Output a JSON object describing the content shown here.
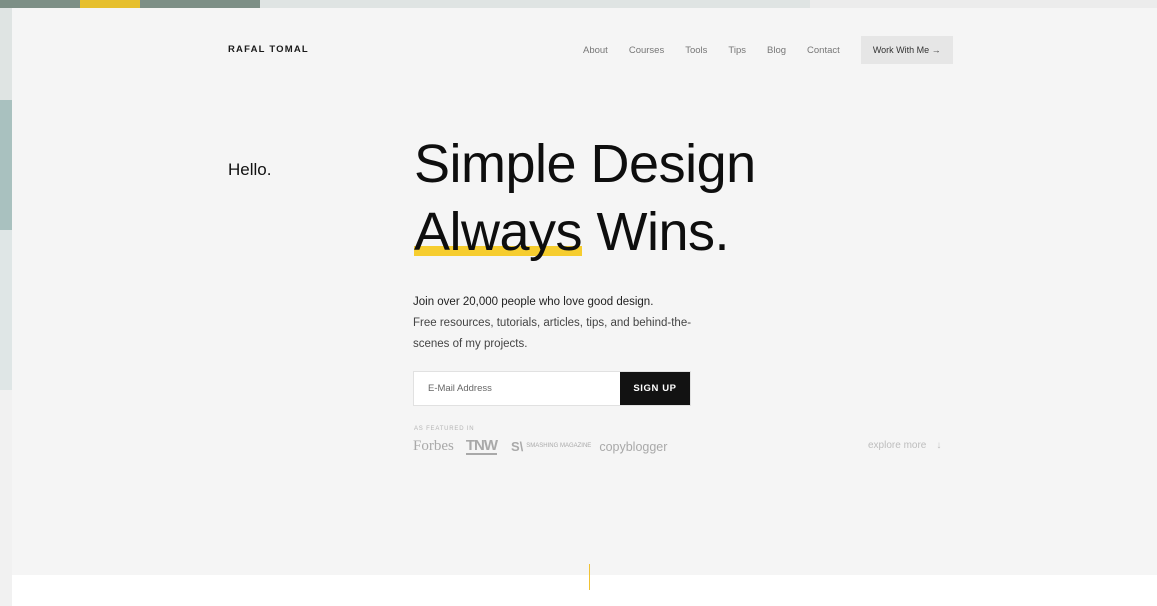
{
  "header": {
    "logo": "RAFAL TOMAL",
    "nav": [
      "About",
      "Courses",
      "Tools",
      "Tips",
      "Blog",
      "Contact"
    ],
    "cta_label": "Work With Me →"
  },
  "hero": {
    "greeting": "Hello.",
    "headline_line1": "Simple Design",
    "headline_highlight": "Always",
    "headline_rest": " Wins.",
    "lead_strong": "Join over 20,000 people who love good design.",
    "lead_sub": "Free resources, tutorials, articles, tips, and behind-the-scenes of my projects."
  },
  "signup": {
    "placeholder": "E-Mail Address",
    "button_label": "SIGN UP"
  },
  "featured": {
    "label": "AS FEATURED IN",
    "logos": {
      "forbes": "Forbes",
      "tnw": "TNW",
      "smashing_mark": "S\\",
      "smashing_text": "SMASHING MAGAZINE",
      "copyblogger": "copyblogger"
    }
  },
  "explore": {
    "label": "explore more",
    "icon": "down-arrow-icon"
  },
  "colors": {
    "accent": "#f6cd2f",
    "page_bg": "#f5f5f5",
    "button_bg": "#121212"
  }
}
